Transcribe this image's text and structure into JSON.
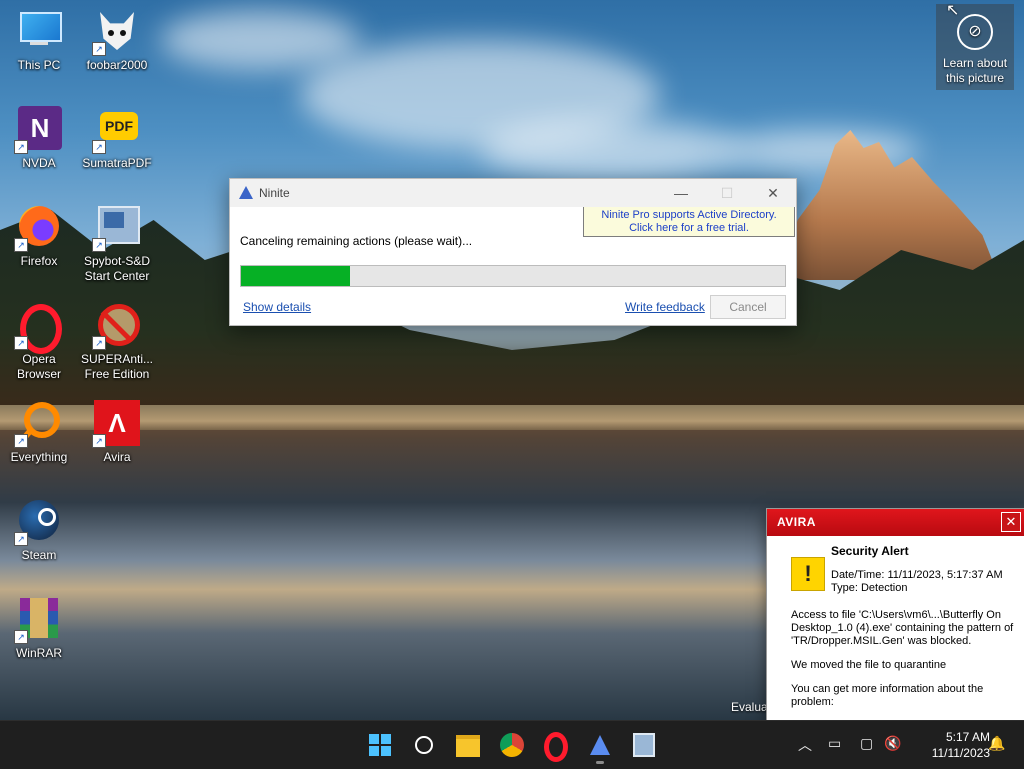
{
  "desktop": {
    "icons": [
      {
        "label": "This PC"
      },
      {
        "label": "foobar2000"
      },
      {
        "label": "NVDA"
      },
      {
        "label": "SumatraPDF"
      },
      {
        "label": "Firefox"
      },
      {
        "label": "Spybot-S&D Start Center"
      },
      {
        "label": "Opera Browser"
      },
      {
        "label": "SUPERAnti... Free Edition"
      },
      {
        "label": "Everything"
      },
      {
        "label": "Avira"
      },
      {
        "label": "Steam"
      },
      {
        "label": "WinRAR"
      }
    ],
    "learn_label": "Learn about this picture",
    "watermark": "Evalua"
  },
  "ninite": {
    "title": "Ninite",
    "promo_line1": "Ninite Pro supports Active Directory.",
    "promo_line2": "Click here for a free trial.",
    "status": "Canceling remaining actions (please wait)...",
    "progress": 0.2,
    "show_details": "Show details",
    "write_feedback": "Write feedback",
    "cancel": "Cancel"
  },
  "avira": {
    "brand": "AVIRA",
    "title": "Security Alert",
    "datetime": "Date/Time: 11/11/2023, 5:17:37 AM",
    "type": "Type: Detection",
    "message": "Access to file 'C:\\Users\\vm6\\...\\Butterfly On Desktop_1.0 (4).exe' containing the pattern of 'TR/Dropper.MSIL.Gen' was blocked.",
    "moved": "We moved the file to quarantine",
    "more": "You can get more information about the problem:"
  },
  "taskbar": {
    "time": "5:17 AM",
    "date": "11/11/2023"
  },
  "colors": {
    "progress_green": "#06b025",
    "avira_red": "#d8121a",
    "taskbar": "#1f1f1f"
  }
}
